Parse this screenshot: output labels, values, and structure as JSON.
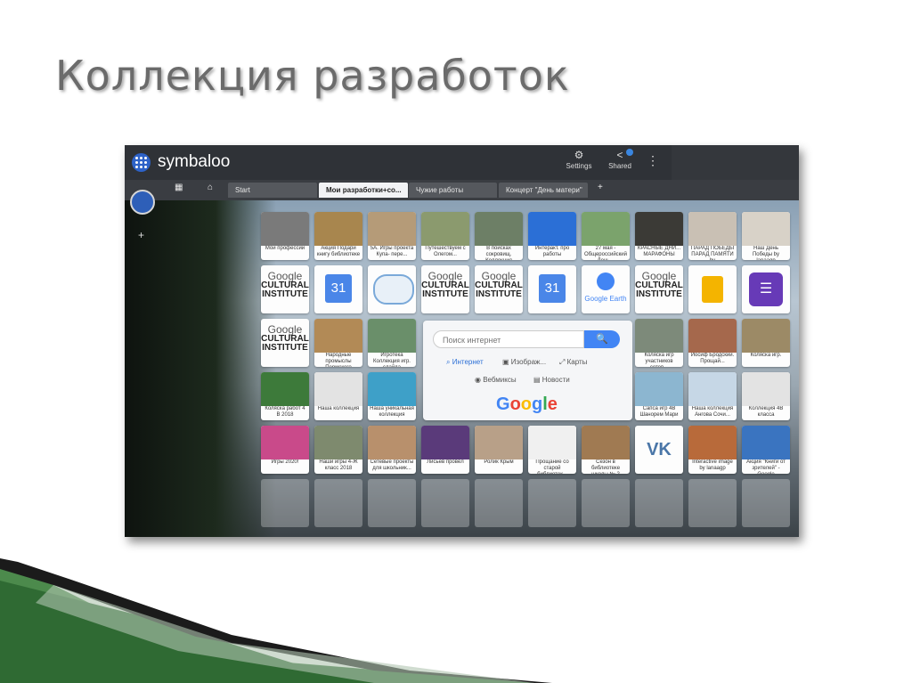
{
  "slide": {
    "title": "Коллекция разработок"
  },
  "app": {
    "name": "symbaloo",
    "settings_label": "Settings",
    "shared_label": "Shared",
    "more_label": "⋮"
  },
  "tabs": [
    {
      "label": "Start"
    },
    {
      "label": "Мои разработки+со..."
    },
    {
      "label": "Чужие работы"
    },
    {
      "label": "Концерт \"День матери\""
    }
  ],
  "tiles": {
    "r1": [
      "Мои профессии",
      "Акция Подари книгу библиотеке",
      "5А. Игры проекта Купа- пере...",
      "Путешествуем с Олегом...",
      "В поисках сокровищ. Коллекция",
      "Интеракт. про работы",
      "27 мая - Общероссийский День...",
      "КРАСНЫЕ ДНИ... МАРАФОНЫ",
      "ПАРАД ПОБЕДЫ ПАРАД ПАМЯТИ by",
      "Наш День Победы by lanaagp"
    ],
    "r3": [
      "Народные промыслы Пермского",
      "Игротека Коллекция игр. слайда",
      "Коляска игр участников сетев...",
      "Иосиф Бродский. Прощай...",
      "Коляска игр."
    ],
    "r4": [
      "Коляска работ 4 В 2018",
      "Наша коллекция",
      "Наша уникальная коллекция",
      "Сапса игр 4В Шанорем Мари",
      "Наша коллекция Ангова Сочи...",
      "Коллекция 4В класса"
    ],
    "r5": [
      "Игры 2020!",
      "Наши игры 4-Ж класс 2018",
      "Сетевые проекты для школьник...",
      "Лисьев провёл",
      "Ролик Крым",
      "Прощание со старой библиотек...",
      "Сезон в библиотеке школы № 2",
      "",
      "Interactive image by lanaagp",
      "Акция \"Книги от зрителей\" - Google"
    ]
  },
  "branding": {
    "google_cultural": [
      "Google",
      "CULTURAL",
      "INSTITUTE"
    ],
    "calendar_day": "31",
    "google_earth": "Google Earth",
    "vk": "VK"
  },
  "search": {
    "placeholder": "Поиск интернет",
    "options": [
      "Интернет",
      "Изображ...",
      "Карты",
      "Вебмиксы",
      "Новости"
    ],
    "brand": "Google"
  },
  "colors": {
    "accent": "#2d62c8",
    "search_button": "#4285f4",
    "topbar": "#2f3237"
  }
}
